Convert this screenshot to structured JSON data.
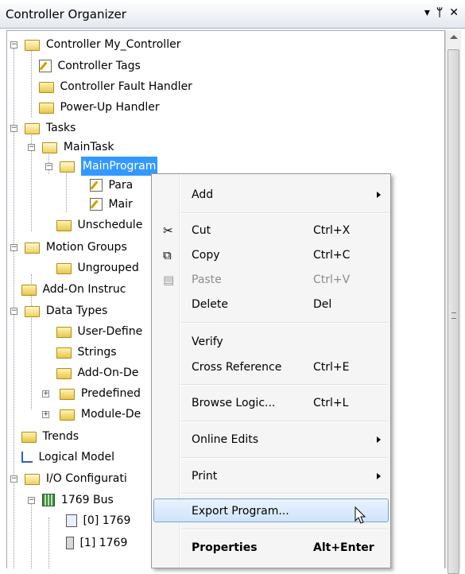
{
  "panel": {
    "title": "Controller Organizer",
    "buttons": [
      "▾",
      "ᛘ",
      "✕"
    ]
  },
  "tree": [
    {
      "label": "Controller My_Controller",
      "icon": "open-folder-icon"
    },
    {
      "label": "Controller Tags",
      "icon": "tag-icon"
    },
    {
      "label": "Controller Fault Handler",
      "icon": "folder-icon"
    },
    {
      "label": "Power-Up Handler",
      "icon": "folder-icon"
    },
    {
      "label": "Tasks",
      "icon": "open-folder-icon"
    },
    {
      "label": "MainTask",
      "icon": "task-icon"
    },
    {
      "label": "MainProgram",
      "icon": "program-icon",
      "selected": true
    },
    {
      "label": "Para",
      "icon": "tag-icon"
    },
    {
      "label": "Mair",
      "icon": "routine-icon"
    },
    {
      "label": "Unschedule",
      "icon": "folder-icon"
    },
    {
      "label": "Motion Groups",
      "icon": "open-folder-icon"
    },
    {
      "label": "Ungrouped",
      "icon": "folder-icon"
    },
    {
      "label": "Add-On Instruc",
      "icon": "folder-icon"
    },
    {
      "label": "Data Types",
      "icon": "open-folder-icon"
    },
    {
      "label": "User-Define",
      "icon": "datatype-icon"
    },
    {
      "label": "Strings",
      "icon": "datatype-icon"
    },
    {
      "label": "Add-On-De",
      "icon": "datatype-icon"
    },
    {
      "label": "Predefined",
      "icon": "datatype-icon"
    },
    {
      "label": "Module-De",
      "icon": "datatype-icon"
    },
    {
      "label": "Trends",
      "icon": "folder-icon"
    },
    {
      "label": "Logical Model",
      "icon": "logical-model-icon"
    },
    {
      "label": "I/O Configurati",
      "icon": "open-folder-icon"
    },
    {
      "label": "1769 Bus",
      "icon": "bus-icon"
    },
    {
      "label": "[0] 1769",
      "icon": "module-icon"
    },
    {
      "label": "[1] 1769",
      "icon": "module-icon"
    }
  ],
  "menu": [
    {
      "label": "Add",
      "shortcut": "",
      "submenu": true
    },
    {
      "label": "Cut",
      "shortcut": "Ctrl+X",
      "icon": "cut-icon"
    },
    {
      "label": "Copy",
      "shortcut": "Ctrl+C",
      "icon": "copy-icon"
    },
    {
      "label": "Paste",
      "shortcut": "Ctrl+V",
      "icon": "paste-icon",
      "disabled": true
    },
    {
      "label": "Delete",
      "shortcut": "Del"
    },
    {
      "label": "Verify",
      "shortcut": ""
    },
    {
      "label": "Cross Reference",
      "shortcut": "Ctrl+E"
    },
    {
      "label": "Browse Logic...",
      "shortcut": "Ctrl+L"
    },
    {
      "label": "Online Edits",
      "shortcut": "",
      "submenu": true
    },
    {
      "label": "Print",
      "shortcut": "",
      "submenu": true
    },
    {
      "label": "Export Program...",
      "shortcut": "",
      "highlighted": true
    },
    {
      "label": "Properties",
      "shortcut": "Alt+Enter",
      "bold": true
    }
  ],
  "colors": {
    "selection": "#3399ff",
    "menu_highlight": "#cfe4fa",
    "menu_background": "#f5f5f5"
  }
}
